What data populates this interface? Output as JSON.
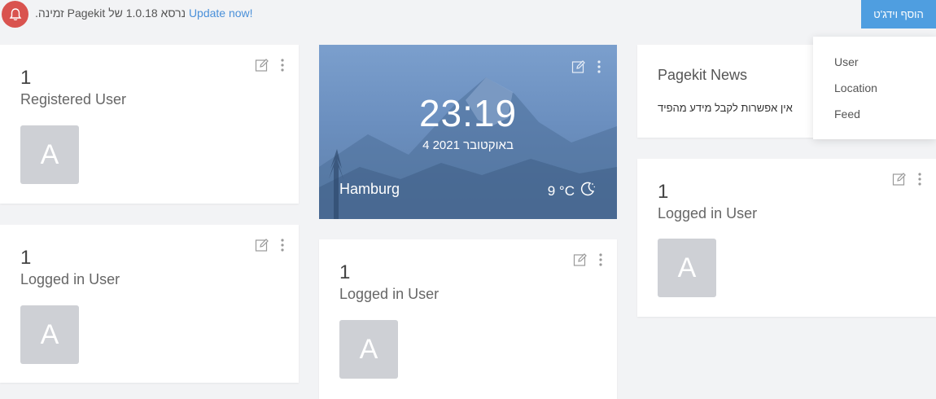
{
  "notice": {
    "message": ".זמינה Pagekit נרסא 1.0.18 של",
    "link_text": "Update now!"
  },
  "toolbar": {
    "add_widget_label": "הוסף וידג'ט"
  },
  "cards": {
    "registered": {
      "count": "1",
      "label": "Registered User",
      "avatar_letter": "A"
    },
    "logged_left": {
      "count": "1",
      "label": "Logged in User",
      "avatar_letter": "A"
    },
    "logged_middle": {
      "count": "1",
      "label": "Logged in User",
      "avatar_letter": "A"
    },
    "logged_right": {
      "count": "1",
      "label": "Logged in User",
      "avatar_letter": "A"
    }
  },
  "clock": {
    "time": "23:19",
    "date": "4 באוקטובר 2021",
    "city": "Hamburg",
    "temperature": "9 °C",
    "weather_icon": "moon-icon"
  },
  "news": {
    "title": "Pagekit News",
    "message": "אין אפשרות לקבל מידע מהפיד"
  },
  "dropdown": {
    "items": [
      "User",
      "Location",
      "Feed"
    ]
  },
  "colors": {
    "accent": "#4f9ee0",
    "alert": "#d9534f",
    "link": "#4a90d9",
    "avatar": "#ced0d5"
  }
}
